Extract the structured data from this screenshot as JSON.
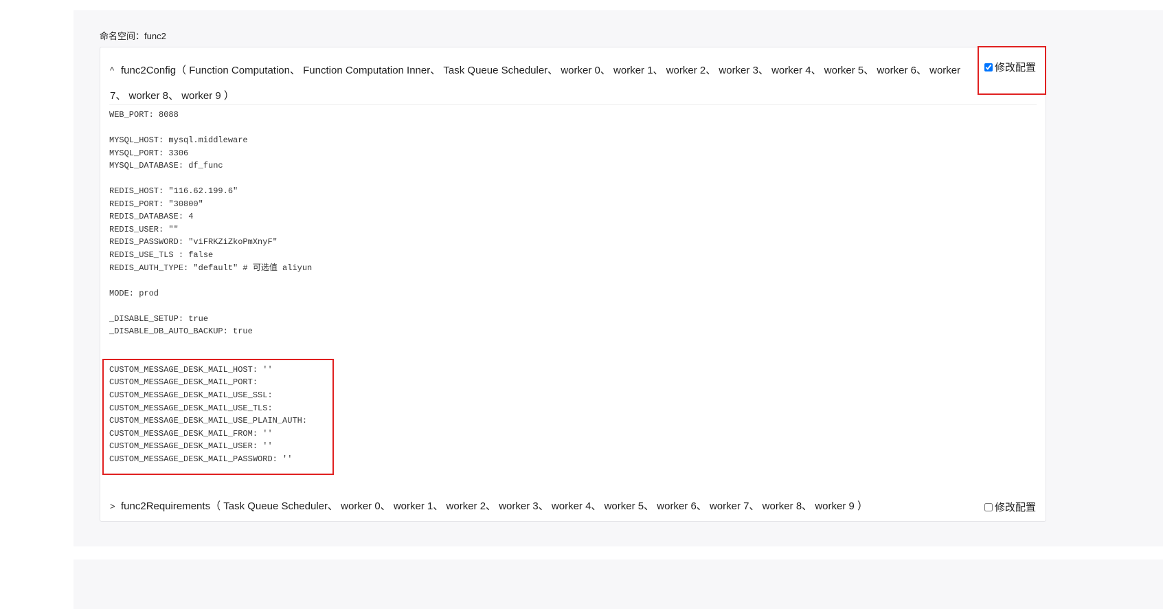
{
  "namespace": {
    "label": "命名空间：",
    "value": "func2"
  },
  "config": {
    "chevron": "^",
    "title": "func2Config（ Function Computation、 Function Computation Inner、 Task Queue Scheduler、 worker 0、 worker 1、 worker 2、 worker 3、 worker 4、 worker 5、 worker 6、 worker 7、 worker 8、 worker 9 ）",
    "edit_label": "修改配置",
    "edit_checked": true,
    "lines": [
      "WEB_PORT: 8088",
      "",
      "MYSQL_HOST: mysql.middleware",
      "MYSQL_PORT: 3306",
      "MYSQL_DATABASE: df_func",
      "",
      "REDIS_HOST: \"116.62.199.6\"",
      "REDIS_PORT: \"30800\"",
      "REDIS_DATABASE: 4",
      "REDIS_USER: \"\"",
      "REDIS_PASSWORD: \"viFRKZiZkoPmXnyF\"",
      "REDIS_USE_TLS : false",
      "REDIS_AUTH_TYPE: \"default\" # 可选值 aliyun",
      "",
      "MODE: prod",
      "",
      "_DISABLE_SETUP: true",
      "_DISABLE_DB_AUTO_BACKUP: true",
      "",
      "",
      "CUSTOM_MESSAGE_DESK_MAIL_HOST: ''",
      "CUSTOM_MESSAGE_DESK_MAIL_PORT:",
      "CUSTOM_MESSAGE_DESK_MAIL_USE_SSL:",
      "CUSTOM_MESSAGE_DESK_MAIL_USE_TLS:",
      "CUSTOM_MESSAGE_DESK_MAIL_USE_PLAIN_AUTH:",
      "CUSTOM_MESSAGE_DESK_MAIL_FROM: ''",
      "CUSTOM_MESSAGE_DESK_MAIL_USER: ''",
      "CUSTOM_MESSAGE_DESK_MAIL_PASSWORD: ''"
    ]
  },
  "requirements": {
    "chevron": ">",
    "title": "func2Requirements（ Task Queue Scheduler、 worker 0、 worker 1、 worker 2、 worker 3、 worker 4、 worker 5、 worker 6、 worker 7、 worker 8、 worker 9 ）",
    "edit_label": "修改配置",
    "edit_checked": false
  },
  "colors": {
    "highlight": "#e02020",
    "panel": "#f7f7f9"
  }
}
